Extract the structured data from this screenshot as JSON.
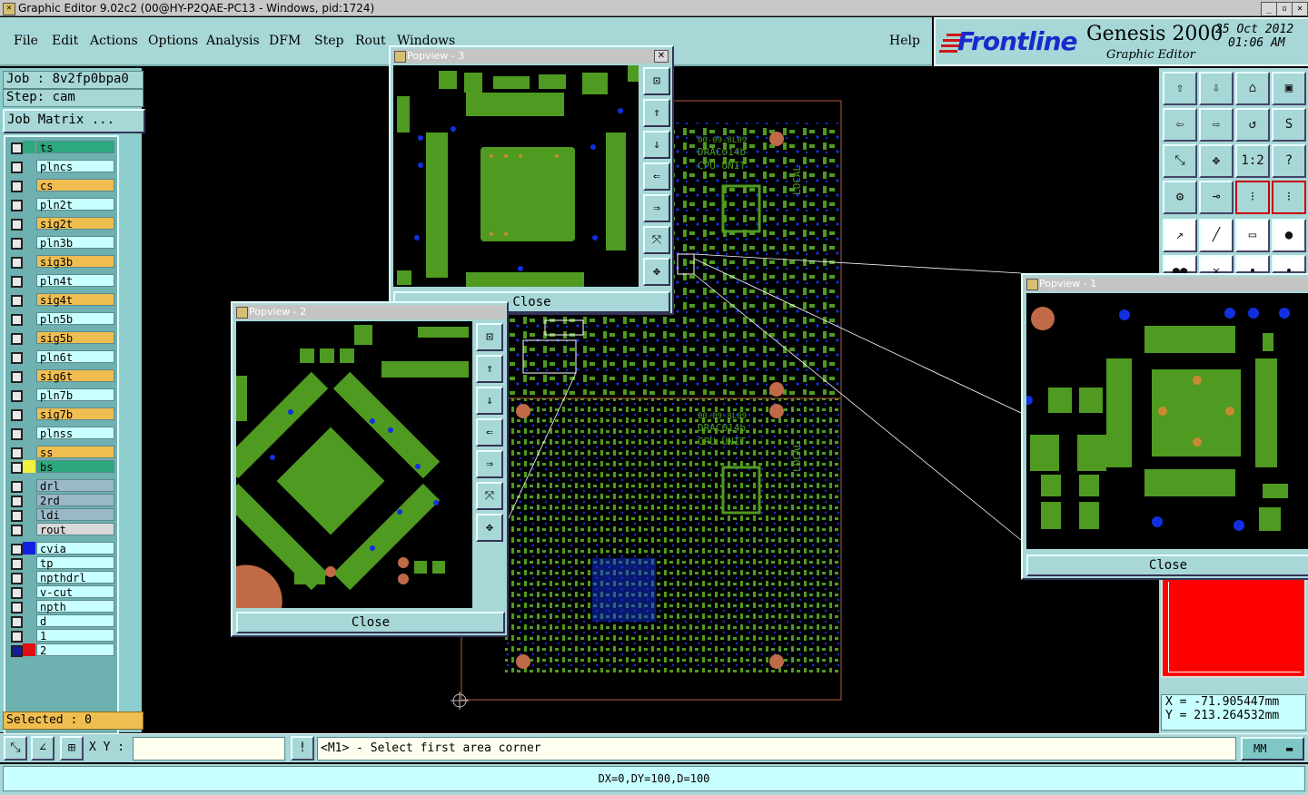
{
  "window": {
    "title": "Graphic Editor 9.02c2 (00@HY-P2QAE-PC13 - Windows, pid:1724)"
  },
  "menu": [
    "File",
    "Edit",
    "Actions",
    "Options",
    "Analysis",
    "DFM",
    "Step",
    "Rout",
    "Windows",
    "Help"
  ],
  "logo": {
    "brand": "Frontline",
    "product": "Genesis 2000",
    "subtitle": "Graphic Editor",
    "date": "25 Oct 2012",
    "time": "01:06 AM"
  },
  "job": {
    "job_label": "Job : 8v2fp0bpa0",
    "step_label": "Step: cam",
    "matrix_button": "Job Matrix ..."
  },
  "layers": [
    {
      "name": "ts",
      "bg": "#2ea87e",
      "swatch": "#2ea87e"
    },
    {
      "name": "plncs",
      "bg": "#c8ffff",
      "swatch": ""
    },
    {
      "name": "cs",
      "bg": "#f0be50",
      "swatch": ""
    },
    {
      "name": "pln2t",
      "bg": "#c8ffff",
      "swatch": ""
    },
    {
      "name": "sig2t",
      "bg": "#f0be50",
      "swatch": ""
    },
    {
      "name": "pln3b",
      "bg": "#c8ffff",
      "swatch": ""
    },
    {
      "name": "sig3b",
      "bg": "#f0be50",
      "swatch": ""
    },
    {
      "name": "pln4t",
      "bg": "#c8ffff",
      "swatch": ""
    },
    {
      "name": "sig4t",
      "bg": "#f0be50",
      "swatch": ""
    },
    {
      "name": "pln5b",
      "bg": "#c8ffff",
      "swatch": ""
    },
    {
      "name": "sig5b",
      "bg": "#f0be50",
      "swatch": ""
    },
    {
      "name": "pln6t",
      "bg": "#c8ffff",
      "swatch": ""
    },
    {
      "name": "sig6t",
      "bg": "#f0be50",
      "swatch": ""
    },
    {
      "name": "pln7b",
      "bg": "#c8ffff",
      "swatch": ""
    },
    {
      "name": "sig7b",
      "bg": "#f0be50",
      "swatch": ""
    },
    {
      "name": "plnss",
      "bg": "#c8ffff",
      "swatch": ""
    },
    {
      "name": "ss",
      "bg": "#f0be50",
      "swatch": ""
    },
    {
      "name": "bs",
      "bg": "#2ea87e",
      "swatch": "#f0f040"
    },
    {
      "name": "drl",
      "bg": "#9ab8c8",
      "swatch": ""
    },
    {
      "name": "2rd",
      "bg": "#9ab8c8",
      "swatch": ""
    },
    {
      "name": "ldi",
      "bg": "#9ab8c8",
      "swatch": ""
    },
    {
      "name": "rout",
      "bg": "#d8d8d8",
      "swatch": ""
    },
    {
      "name": "cvia",
      "bg": "#c8ffff",
      "swatch": "#1020e0"
    },
    {
      "name": "tp",
      "bg": "#c8ffff",
      "swatch": ""
    },
    {
      "name": "npthdrl",
      "bg": "#c8ffff",
      "swatch": ""
    },
    {
      "name": "v-cut",
      "bg": "#c8ffff",
      "swatch": ""
    },
    {
      "name": "npth",
      "bg": "#c8ffff",
      "swatch": ""
    },
    {
      "name": "d",
      "bg": "#c8ffff",
      "swatch": ""
    },
    {
      "name": "1",
      "bg": "#c8ffff",
      "swatch": ""
    },
    {
      "name": "2",
      "bg": "#c8ffff",
      "swatch": "#e01010"
    }
  ],
  "selected": "Selected : 0",
  "popups": {
    "p1": {
      "title": "Popview - 1",
      "close": "Close"
    },
    "p2": {
      "title": "Popview - 2",
      "close": "Close"
    },
    "p3": {
      "title": "Popview - 3",
      "close": "Close"
    }
  },
  "board": {
    "label1": "00-09-8L09",
    "label2": "DRAC014b",
    "label3": "CPU UNIT",
    "label4": "LOCAL"
  },
  "coords": {
    "x": "X = -71.905447mm",
    "y": "Y = 213.264532mm"
  },
  "cmd": {
    "xy_label": "X Y :",
    "xy_value": "",
    "prompt": "<M1> - Select first area corner",
    "units": "MM"
  },
  "status": "DX=0,DY=100,D=100",
  "colors": {
    "panel": "#a7d7d7",
    "copper": "#4f9a20",
    "pad": "#c06a48",
    "via": "#1030e0"
  }
}
